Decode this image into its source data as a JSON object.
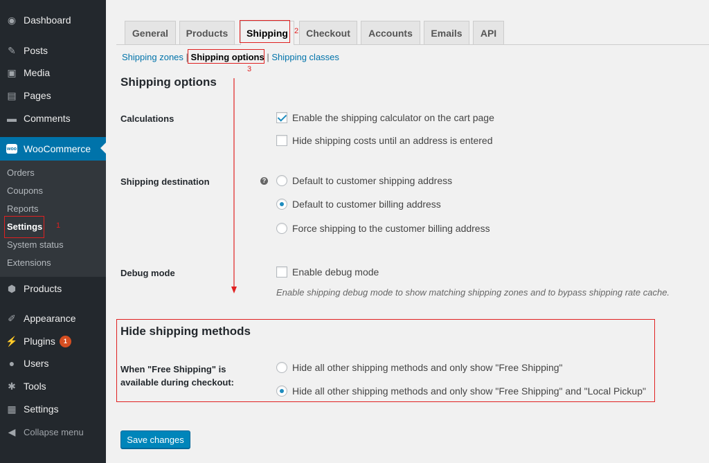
{
  "sidebar": {
    "dashboard": "Dashboard",
    "posts": "Posts",
    "media": "Media",
    "pages": "Pages",
    "comments": "Comments",
    "woocommerce": "WooCommerce",
    "woo_logo": "woo",
    "submenu": [
      "Orders",
      "Coupons",
      "Reports",
      "Settings",
      "System status",
      "Extensions"
    ],
    "products": "Products",
    "appearance": "Appearance",
    "plugins": "Plugins",
    "plugins_badge": "1",
    "users": "Users",
    "tools": "Tools",
    "settings": "Settings",
    "collapse": "Collapse menu"
  },
  "tabs": [
    "General",
    "Products",
    "Shipping",
    "Checkout",
    "Accounts",
    "Emails",
    "API"
  ],
  "subnav": {
    "zones": "Shipping zones",
    "options": "Shipping options",
    "classes": "Shipping classes",
    "sep": "|"
  },
  "annotations": [
    "1",
    "2",
    "3"
  ],
  "section1": {
    "title": "Shipping options",
    "calculations_label": "Calculations",
    "calc_opt1": "Enable the shipping calculator on the cart page",
    "calc_opt2": "Hide shipping costs until an address is entered",
    "destination_label": "Shipping destination",
    "help": "?",
    "dest_opt1": "Default to customer shipping address",
    "dest_opt2": "Default to customer billing address",
    "dest_opt3": "Force shipping to the customer billing address",
    "debug_label": "Debug mode",
    "debug_opt": "Enable debug mode",
    "debug_desc": "Enable shipping debug mode to show matching shipping zones and to bypass shipping rate cache."
  },
  "section2": {
    "title": "Hide shipping methods",
    "label_line1": "When \"Free Shipping\" is",
    "label_line2": "available during checkout:",
    "opt1": "Hide all other shipping methods and only show \"Free Shipping\"",
    "opt2": "Hide all other shipping methods and only show \"Free Shipping\" and \"Local Pickup\""
  },
  "save_label": "Save changes",
  "colors": {
    "sidebar": "#23282d",
    "accent": "#0073aa",
    "annotation": "#e02020"
  }
}
